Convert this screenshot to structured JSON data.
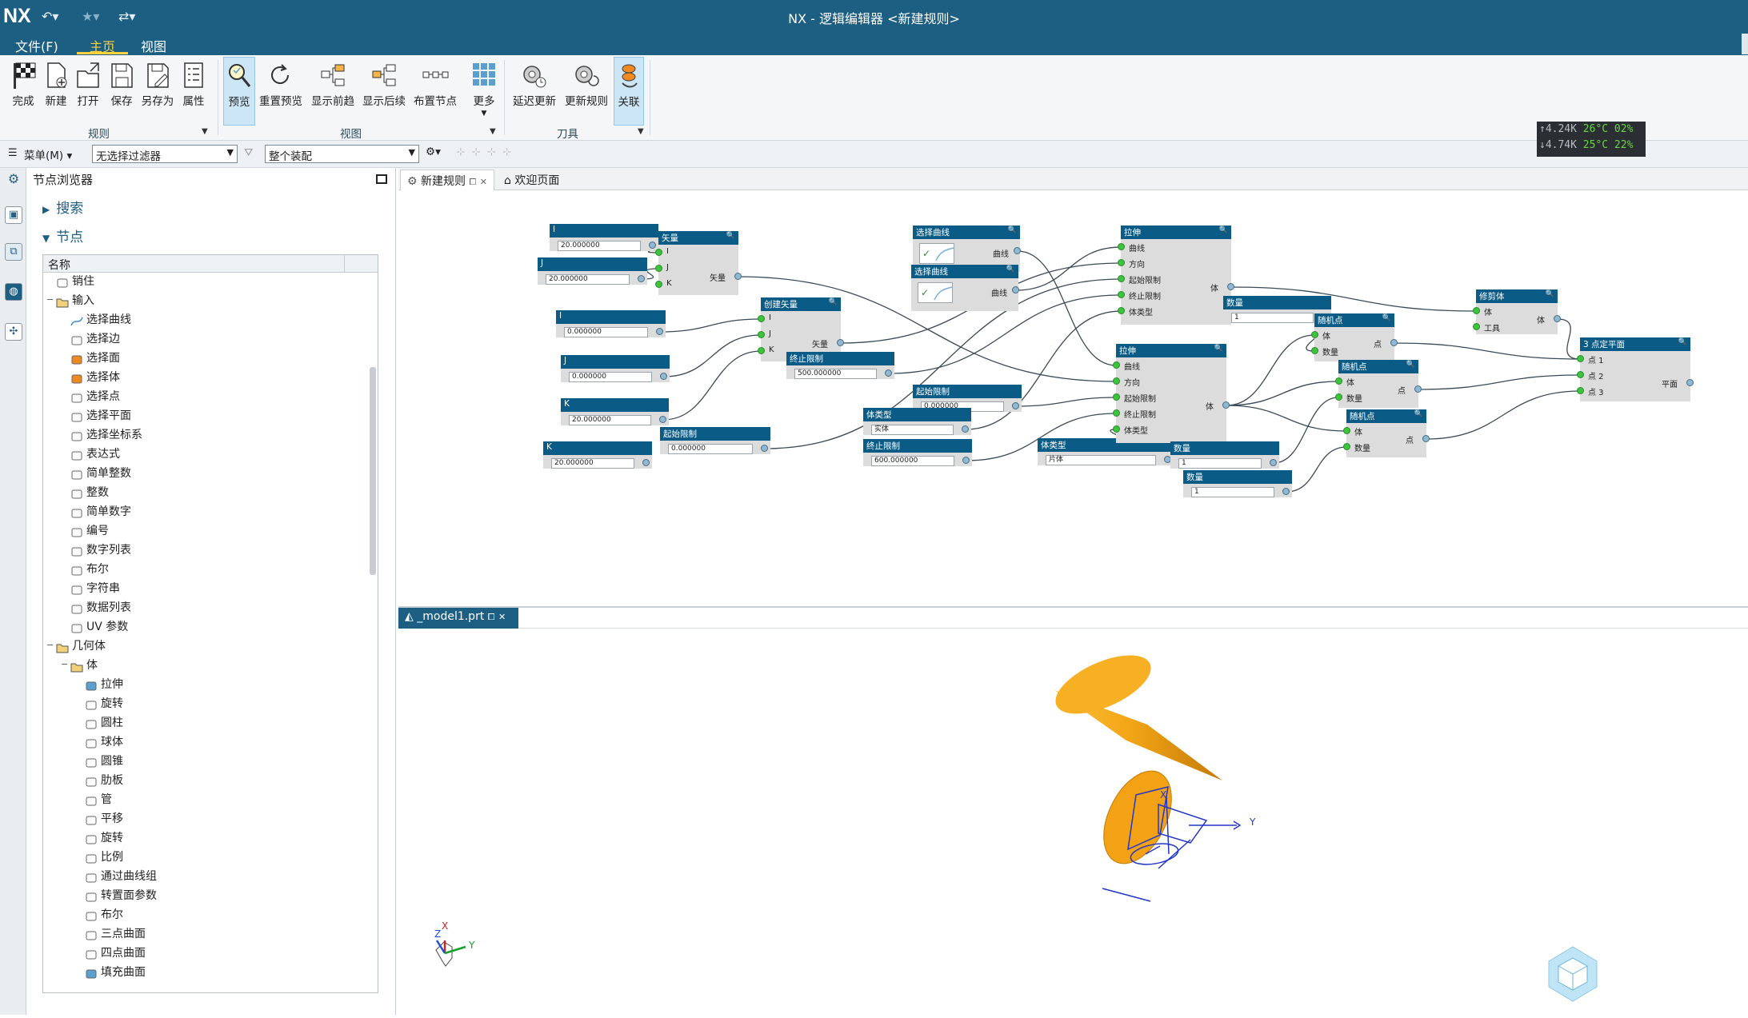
{
  "app": {
    "logo": "NX",
    "window_title": "NX - 逻辑编辑器 <新建规则>"
  },
  "menu": {
    "file": "文件(F)",
    "home": "主页",
    "view": "视图"
  },
  "ribbon": {
    "buttons": [
      "完成",
      "新建",
      "打开",
      "保存",
      "另存为",
      "属性",
      "预览",
      "重置预览",
      "显示前趋",
      "显示后续",
      "布置节点",
      "更多",
      "延迟更新",
      "更新规则",
      "关联"
    ],
    "groups": [
      "规则",
      "视图",
      "刀具"
    ]
  },
  "filterbar": {
    "menu_label": "菜单(M)",
    "filter_value": "无选择过滤器",
    "assembly_value": "整个装配"
  },
  "perf": {
    "line1_a": "↑4.24K",
    "line1_b": "26°C  02%",
    "line2_a": "↓4.74K",
    "line2_b": "25°C  22%"
  },
  "navigator": {
    "title": "节点浏览器",
    "search_label": "搜索",
    "nodes_label": "节点",
    "column_name": "名称",
    "items": [
      {
        "label": "销住",
        "level": 1,
        "icon": "pin-icon"
      },
      {
        "label": "输入",
        "level": 1,
        "icon": "folder-icon",
        "expander": "−"
      },
      {
        "label": "选择曲线",
        "level": 2,
        "icon": "curve-icon"
      },
      {
        "label": "选择边",
        "level": 2,
        "icon": "edge-icon"
      },
      {
        "label": "选择面",
        "level": 2,
        "icon": "face-icon"
      },
      {
        "label": "选择体",
        "level": 2,
        "icon": "body-icon"
      },
      {
        "label": "选择点",
        "level": 2,
        "icon": "point-icon"
      },
      {
        "label": "选择平面",
        "level": 2,
        "icon": "plane-icon"
      },
      {
        "label": "选择坐标系",
        "level": 2,
        "icon": "csys-icon"
      },
      {
        "label": "表达式",
        "level": 2,
        "icon": "expression-icon"
      },
      {
        "label": "简单整数",
        "level": 2,
        "icon": "integer-icon"
      },
      {
        "label": "整数",
        "level": 2,
        "icon": "integer-icon"
      },
      {
        "label": "简单数字",
        "level": 2,
        "icon": "number-icon"
      },
      {
        "label": "编号",
        "level": 2,
        "icon": "number-icon"
      },
      {
        "label": "数字列表",
        "level": 2,
        "icon": "list-icon"
      },
      {
        "label": "布尔",
        "level": 2,
        "icon": "checkbox-icon"
      },
      {
        "label": "字符串",
        "level": 2,
        "icon": "string-icon"
      },
      {
        "label": "数据列表",
        "level": 2,
        "icon": "list-icon"
      },
      {
        "label": "UV 参数",
        "level": 2,
        "icon": "uv-icon"
      },
      {
        "label": "几何体",
        "level": 1,
        "icon": "folder-icon",
        "expander": "−"
      },
      {
        "label": "体",
        "level": 2,
        "icon": "folder-icon",
        "expander": "−"
      },
      {
        "label": "拉伸",
        "level": 3,
        "icon": "extrude-icon"
      },
      {
        "label": "旋转",
        "level": 3,
        "icon": "revolve-icon"
      },
      {
        "label": "圆柱",
        "level": 3,
        "icon": "cylinder-icon"
      },
      {
        "label": "球体",
        "level": 3,
        "icon": "sphere-icon"
      },
      {
        "label": "圆锥",
        "level": 3,
        "icon": "cone-icon"
      },
      {
        "label": "肋板",
        "level": 3,
        "icon": "rib-icon"
      },
      {
        "label": "管",
        "level": 3,
        "icon": "tube-icon"
      },
      {
        "label": "平移",
        "level": 3,
        "icon": "translate-icon"
      },
      {
        "label": "旋转",
        "level": 3,
        "icon": "rotate-icon"
      },
      {
        "label": "比例",
        "level": 3,
        "icon": "scale-icon"
      },
      {
        "label": "通过曲线组",
        "level": 3,
        "icon": "through-curves-icon"
      },
      {
        "label": "转置面参数",
        "level": 3,
        "icon": "transpose-icon"
      },
      {
        "label": "布尔",
        "level": 3,
        "icon": "boolean-icon"
      },
      {
        "label": "三点曲面",
        "level": 3,
        "icon": "surface-icon"
      },
      {
        "label": "四点曲面",
        "level": 3,
        "icon": "surface-icon"
      },
      {
        "label": "填充曲面",
        "level": 3,
        "icon": "fill-icon"
      }
    ]
  },
  "tabs_top": {
    "rule": "新建规则",
    "welcome": "欢迎页面"
  },
  "tabs_bottom": {
    "model": "_model1.prt"
  },
  "graph": {
    "nodes": {
      "n_i1": {
        "title": "I",
        "value": "20.000000"
      },
      "n_j1": {
        "title": "J",
        "value": "20.000000"
      },
      "n_vec1": {
        "title": "矢量",
        "pins_in": [
          "I",
          "J",
          "K"
        ],
        "pin_out": "矢量"
      },
      "n_i2": {
        "title": "I",
        "value": "0.000000"
      },
      "n_j2": {
        "title": "J",
        "value": "0.000000"
      },
      "n_k2": {
        "title": "K",
        "value": "20.000000"
      },
      "n_k1": {
        "title": "K",
        "value": "20.000000"
      },
      "n_create_vec": {
        "title": "创建矢量",
        "pins_in": [
          "I",
          "J",
          "K"
        ],
        "pin_out": "矢量"
      },
      "n_start1": {
        "title": "起始限制",
        "value": "0.000000"
      },
      "n_curve1": {
        "title": "选择曲线",
        "pin_out": "曲线"
      },
      "n_end1": {
        "title": "终止限制",
        "value": "500.000000"
      },
      "n_curve2": {
        "title": "选择曲线",
        "pin_out": "曲线"
      },
      "n_start2": {
        "title": "起始限制",
        "value": "0.000000"
      },
      "n_bodytype1": {
        "title": "体类型",
        "value": "实体"
      },
      "n_end2": {
        "title": "终止限制",
        "value": "600.000000"
      },
      "n_bodytype2": {
        "title": "体类型",
        "value": "片体"
      },
      "n_extrude1": {
        "title": "拉伸",
        "pins_in": [
          "曲线",
          "方向",
          "起始限制",
          "终止限制",
          "体类型"
        ],
        "pin_out": "体"
      },
      "n_extrude2": {
        "title": "拉伸",
        "pins_in": [
          "曲线",
          "方向",
          "起始限制",
          "终止限制",
          "体类型"
        ],
        "pin_out": "体"
      },
      "n_count1": {
        "title": "数量",
        "value": "1"
      },
      "n_count2": {
        "title": "数量",
        "value": "1"
      },
      "n_count3": {
        "title": "数量",
        "value": "1"
      },
      "n_trim": {
        "title": "修剪体",
        "pins_in": [
          "体",
          "工具"
        ],
        "pin_out": "体"
      },
      "n_rand1": {
        "title": "随机点",
        "pins_in": [
          "体",
          "数量"
        ],
        "pin_out": "点"
      },
      "n_rand2": {
        "title": "随机点",
        "pins_in": [
          "体",
          "数量"
        ],
        "pin_out": "点"
      },
      "n_rand3": {
        "title": "随机点",
        "pins_in": [
          "体",
          "数量"
        ],
        "pin_out": "点"
      },
      "n_3pt": {
        "title": "3 点定平面",
        "pins_in": [
          "点 1",
          "点 2",
          "点 3"
        ],
        "pin_out": "平面"
      }
    }
  },
  "viewport": {
    "axis_x": "X",
    "axis_y": "Y",
    "axis_z": "Z",
    "cylinder_color": "#f0a818"
  }
}
